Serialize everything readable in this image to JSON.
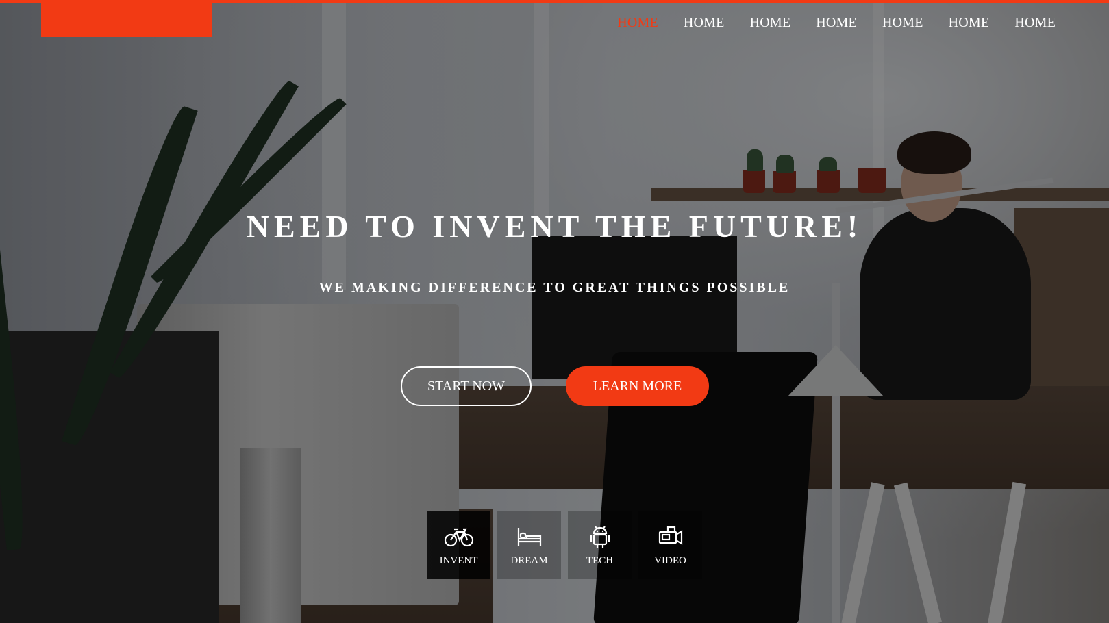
{
  "nav": {
    "items": [
      {
        "label": "HOME",
        "active": true
      },
      {
        "label": "HOME",
        "active": false
      },
      {
        "label": "HOME",
        "active": false
      },
      {
        "label": "HOME",
        "active": false
      },
      {
        "label": "HOME",
        "active": false
      },
      {
        "label": "HOME",
        "active": false
      },
      {
        "label": "HOME",
        "active": false
      }
    ]
  },
  "hero": {
    "headline": "NEED TO INVENT THE FUTURE!",
    "subheadline": "WE MAKING DIFFERENCE TO GREAT THINGS POSSIBLE",
    "primary_cta": "LEARN MORE",
    "secondary_cta": "START NOW"
  },
  "features": [
    {
      "label": "INVENT",
      "icon": "bicycle-icon",
      "active": true
    },
    {
      "label": "DREAM",
      "icon": "bed-icon",
      "active": false
    },
    {
      "label": "TECH",
      "icon": "android-icon",
      "active": false
    },
    {
      "label": "VIDEO",
      "icon": "video-camera-icon",
      "active": false
    }
  ],
  "colors": {
    "accent": "#f23a14",
    "text": "#ffffff"
  }
}
